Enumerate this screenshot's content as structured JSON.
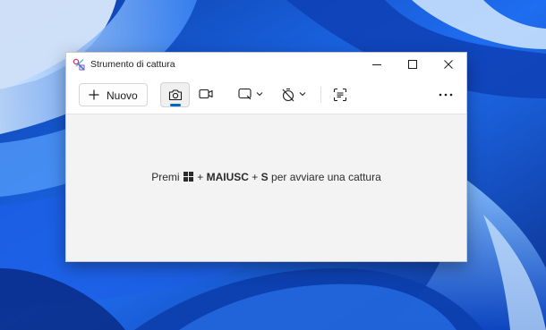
{
  "window": {
    "title": "Strumento di cattura",
    "controls": {
      "minimize_icon": "minimize-icon",
      "maximize_icon": "maximize-icon",
      "close_icon": "close-icon"
    }
  },
  "toolbar": {
    "new_label": "Nuovo",
    "new_icon": "plus-icon",
    "modes": [
      {
        "icon": "camera-icon",
        "selected": true
      },
      {
        "icon": "video-camera-icon",
        "selected": false
      }
    ],
    "shape_icon": "rectangle-snip-icon",
    "timer_icon": "no-timer-icon",
    "text_actions_icon": "text-actions-icon",
    "more_icon": "more-options-icon"
  },
  "hint": {
    "prefix": "Premi",
    "key_icon": "windows-key-icon",
    "plus1": "+",
    "key1": "MAIUSC",
    "plus2": "+",
    "key2": "S",
    "suffix": "per avviare una cattura"
  },
  "colors": {
    "accent": "#0067c0",
    "wallpaper": "#1a5fe0"
  }
}
